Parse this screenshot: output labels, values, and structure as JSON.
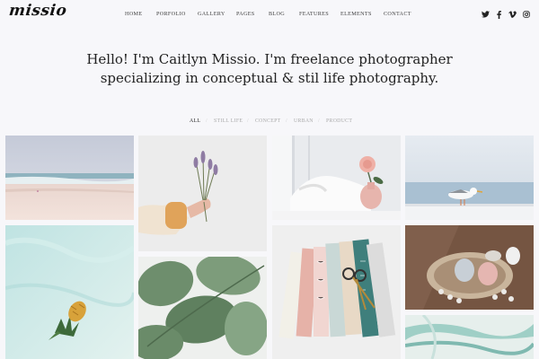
{
  "brand": {
    "logo_text": "missio"
  },
  "nav": {
    "items": [
      "HOME",
      "PORFOLIO",
      "GALLERY",
      "PAGES",
      "BLOG",
      "FEATURES",
      "ELEMENTS",
      "CONTACT"
    ]
  },
  "social": [
    "twitter-icon",
    "facebook-icon",
    "vimeo-icon",
    "instagram-icon"
  ],
  "hero": {
    "line1": "Hello! I'm Caitlyn Missio. I'm freelance photographer",
    "line2": "specializing in conceptual & stil life photography."
  },
  "filters": {
    "items": [
      "ALL",
      "STILL LIFE",
      "CONCEPT",
      "URBAN",
      "PRODUCT"
    ],
    "active": "ALL"
  },
  "gallery": {
    "tiles": [
      "beach-photo",
      "lavender-bouquet-photo",
      "pink-rose-vase-photo",
      "seagull-photo",
      "pineapple-water-photo",
      "eucalyptus-leaves-photo",
      "fabric-swatches-photo",
      "easter-eggs-photo",
      "marble-pattern-photo"
    ]
  },
  "colors": {
    "background": "#f7f7fa",
    "text": "#222222",
    "muted": "#aaaaaa"
  }
}
